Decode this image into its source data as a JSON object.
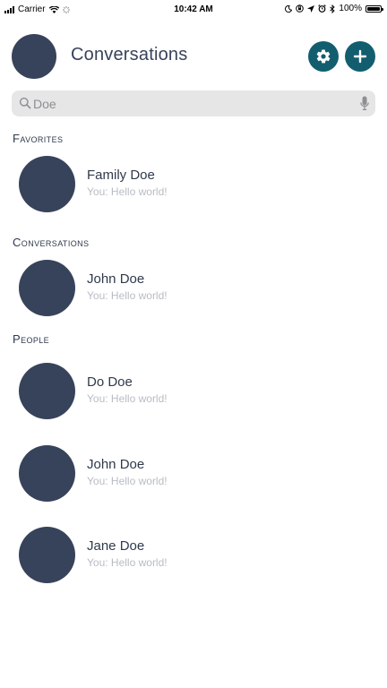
{
  "status_bar": {
    "carrier": "Carrier",
    "time": "10:42 AM",
    "battery": "100%"
  },
  "header": {
    "title": "Conversations",
    "settings_icon": "gear-icon",
    "add_icon": "plus-icon"
  },
  "search": {
    "value": "Doe",
    "icon": "search-icon",
    "mic_icon": "microphone-icon"
  },
  "sections": {
    "favorites": {
      "title": "Favorites",
      "items": [
        {
          "name": "Family Doe",
          "preview": "You: Hello world!"
        }
      ]
    },
    "conversations": {
      "title": "Conversations",
      "items": [
        {
          "name": "John Doe",
          "preview": "You: Hello world!"
        }
      ]
    },
    "people": {
      "title": "People",
      "items": [
        {
          "name": "Do Doe",
          "preview": "You: Hello world!"
        },
        {
          "name": "John Doe",
          "preview": "You: Hello world!"
        },
        {
          "name": "Jane Doe",
          "preview": "You: Hello world!"
        }
      ]
    }
  },
  "colors": {
    "accent": "#125e6f",
    "avatar": "#37435a",
    "text": "#2f3a4c",
    "muted": "#b8bcc4",
    "search_bg": "#e6e6e6"
  }
}
